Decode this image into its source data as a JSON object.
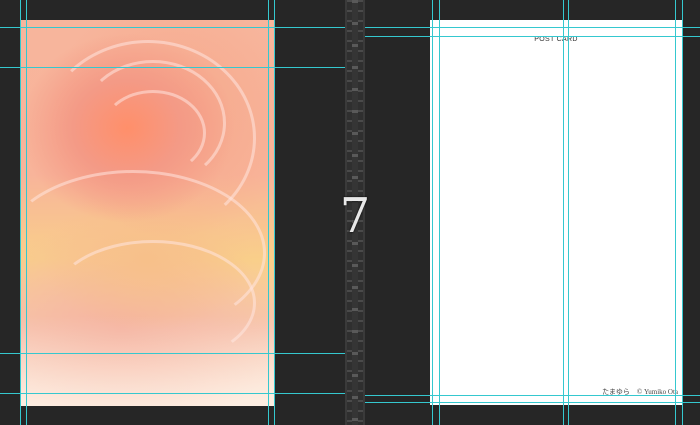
{
  "spread": {
    "page_number": "7"
  },
  "left_page": {
    "image": "rose-photo"
  },
  "right_page": {
    "postcard": {
      "header": "POST CARD",
      "credit": "たまゆら　© Yumiko Ota"
    }
  },
  "colors": {
    "canvas_background": "#262626",
    "guide_color": "#35c8cf",
    "paper": "#ffffff"
  }
}
